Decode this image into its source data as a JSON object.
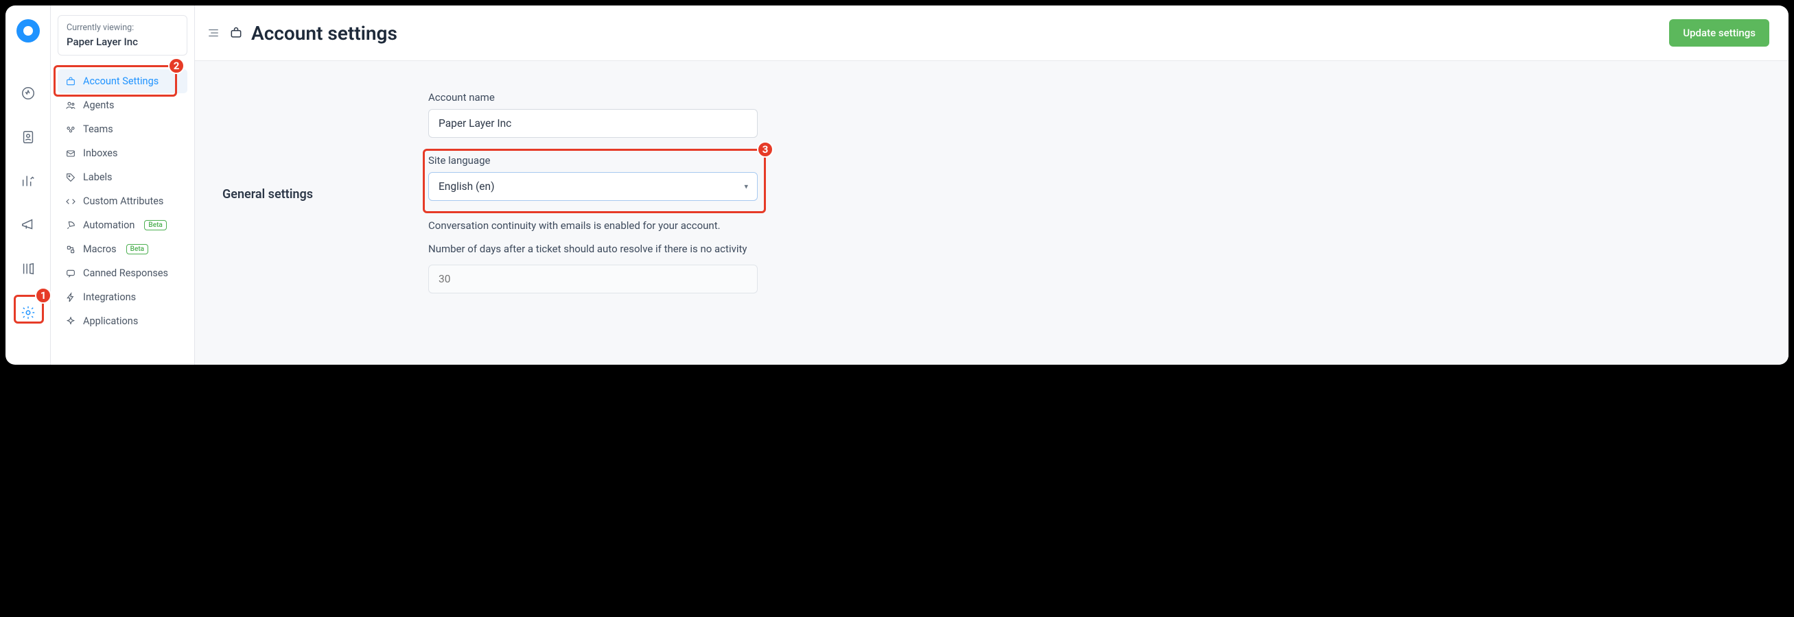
{
  "viewing": {
    "label": "Currently viewing:",
    "value": "Paper Layer Inc"
  },
  "nav": {
    "items": [
      {
        "label": "Account Settings"
      },
      {
        "label": "Agents"
      },
      {
        "label": "Teams"
      },
      {
        "label": "Inboxes"
      },
      {
        "label": "Labels"
      },
      {
        "label": "Custom Attributes"
      },
      {
        "label": "Automation",
        "badge": "Beta"
      },
      {
        "label": "Macros",
        "badge": "Beta"
      },
      {
        "label": "Canned Responses"
      },
      {
        "label": "Integrations"
      },
      {
        "label": "Applications"
      }
    ]
  },
  "header": {
    "title": "Account settings",
    "update_btn": "Update settings"
  },
  "section": {
    "general": "General settings"
  },
  "form": {
    "account_name": {
      "label": "Account name",
      "value": "Paper Layer Inc"
    },
    "site_language": {
      "label": "Site language",
      "value": "English (en)"
    },
    "hint1": "Conversation continuity with emails is enabled for your account.",
    "hint2": "Number of days after a ticket should auto resolve if there is no activity",
    "auto_resolve": {
      "placeholder": "30"
    }
  },
  "callouts": {
    "c1": "1",
    "c2": "2",
    "c3": "3"
  }
}
